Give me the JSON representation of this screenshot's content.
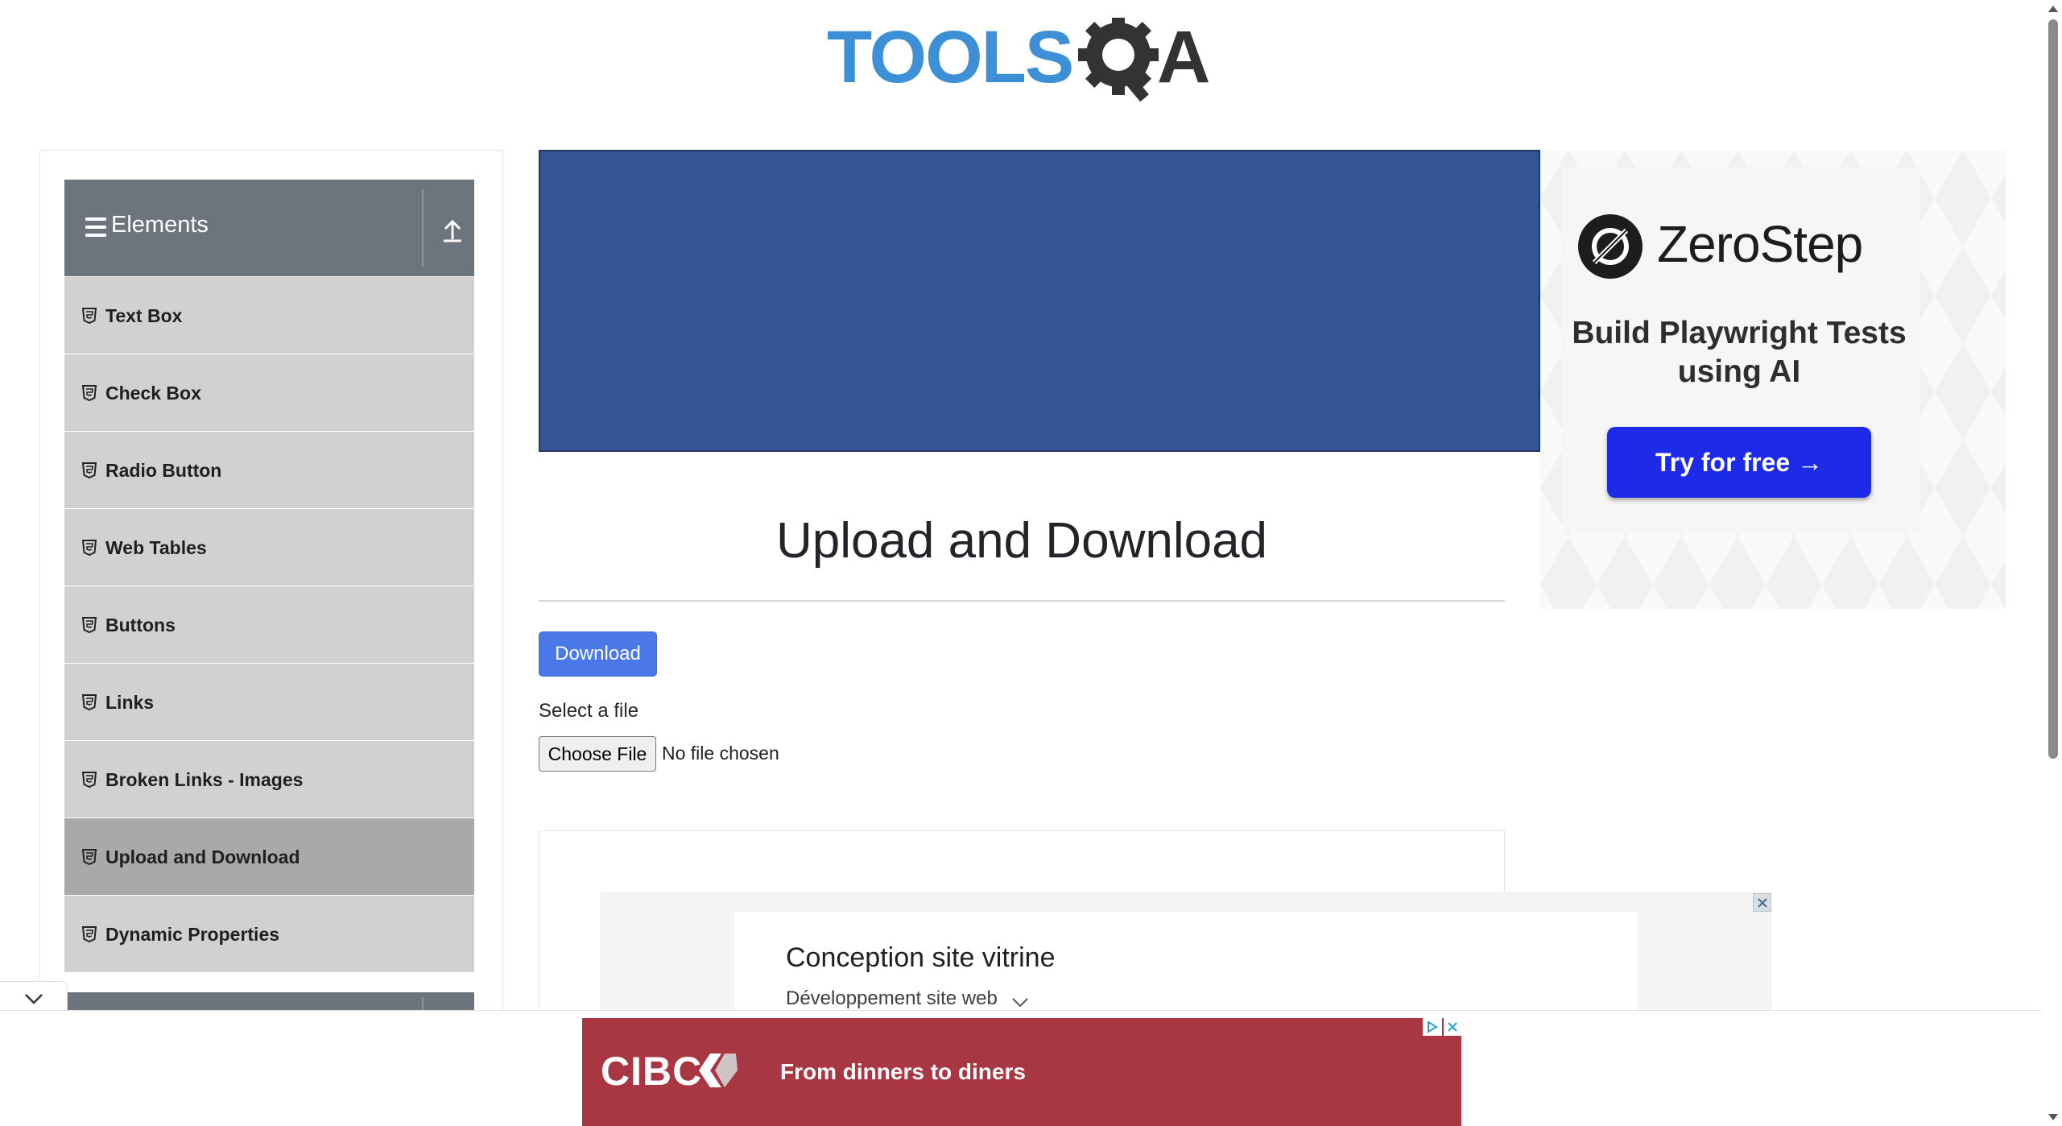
{
  "header": {
    "logo_text": "TOOLSQA",
    "logo_colors": {
      "tools": "#3d8fd6",
      "qa": "#333333"
    }
  },
  "sidebar": {
    "group_title": "Elements",
    "items": [
      {
        "label": "Text Box"
      },
      {
        "label": "Check Box"
      },
      {
        "label": "Radio Button"
      },
      {
        "label": "Web Tables"
      },
      {
        "label": "Buttons"
      },
      {
        "label": "Links"
      },
      {
        "label": "Broken Links - Images"
      },
      {
        "label": "Upload and Download",
        "active": true
      },
      {
        "label": "Dynamic Properties"
      }
    ],
    "item_icon": "html5-shield-icon"
  },
  "main": {
    "title": "Upload and Download",
    "download_label": "Download",
    "select_file_label": "Select a file",
    "choose_file_label": "Choose File",
    "no_file_text": "No file chosen"
  },
  "ads": {
    "zerostep": {
      "brand": "ZeroStep",
      "tagline": "Build Playwright Tests using AI",
      "cta": "Try for free →",
      "cta_color": "#1d2be8"
    },
    "mid": {
      "title": "Conception site vitrine",
      "subtitle": "Développement site web"
    },
    "cibc": {
      "brand": "CIBC",
      "text": "From dinners to diners",
      "color": "#a93643"
    }
  },
  "colors": {
    "sidebar_header": "#6c757d",
    "menu_item": "#d1d1d1",
    "menu_item_active": "#a9a9a9",
    "primary_button": "#4a78e8",
    "top_ad": "#345593"
  }
}
